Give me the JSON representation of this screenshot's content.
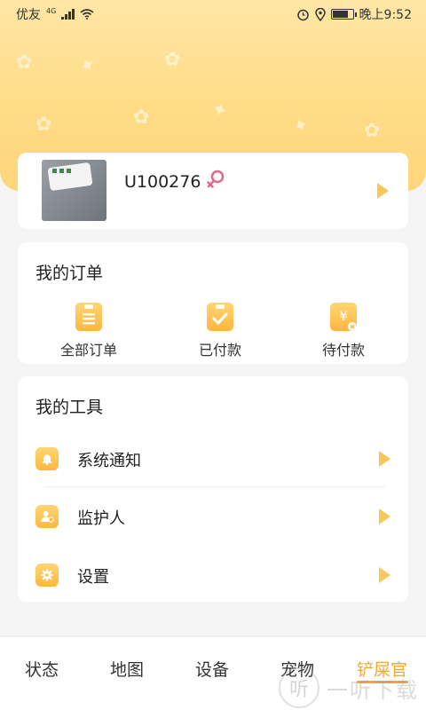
{
  "status_bar": {
    "carrier": "优友",
    "network_type": "4G",
    "time": "晚上9:52",
    "icons": [
      "signal-icon",
      "wifi-icon",
      "alarm-icon",
      "location-icon",
      "battery-icon"
    ]
  },
  "profile": {
    "user_id": "U100276",
    "gender_icon": "female-icon",
    "avatar_icon": "device-photo"
  },
  "orders": {
    "title": "我的订单",
    "items": [
      {
        "label": "全部订单",
        "icon": "clipboard-list-icon"
      },
      {
        "label": "已付款",
        "icon": "clipboard-check-icon"
      },
      {
        "label": "待付款",
        "icon": "yuan-pending-icon"
      }
    ]
  },
  "tools": {
    "title": "我的工具",
    "items": [
      {
        "label": "系统通知",
        "icon": "bell-icon"
      },
      {
        "label": "监护人",
        "icon": "guardian-icon"
      },
      {
        "label": "设置",
        "icon": "gear-icon"
      }
    ]
  },
  "bottom_nav": {
    "items": [
      {
        "label": "状态"
      },
      {
        "label": "地图"
      },
      {
        "label": "设备"
      },
      {
        "label": "宠物"
      },
      {
        "label": "铲屎官"
      }
    ],
    "active_index": 4
  },
  "watermark": {
    "text": "一听下载",
    "logo_char": "听"
  },
  "colors": {
    "accent": "#f0a833",
    "arrow": "#f6c85c",
    "header_top": "#ffe7a6",
    "header_bottom": "#ffd57a",
    "female": "#e26a8c"
  }
}
